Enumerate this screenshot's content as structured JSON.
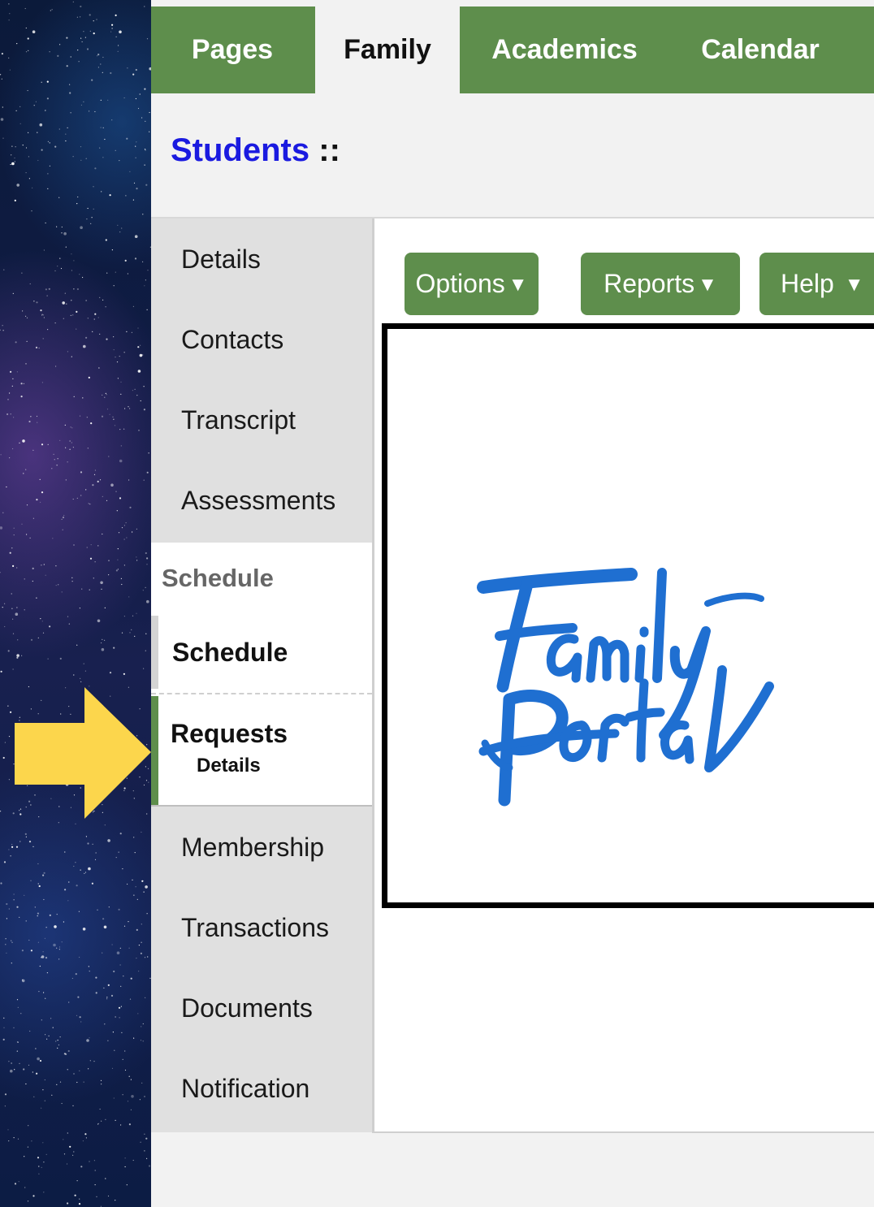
{
  "nav": {
    "tabs": [
      {
        "label": "Pages",
        "active": false
      },
      {
        "label": "Family",
        "active": true
      },
      {
        "label": "Academics",
        "active": false
      },
      {
        "label": "Calendar",
        "active": false
      }
    ]
  },
  "header": {
    "breadcrumb": "Students",
    "separator": "::"
  },
  "sidebar": {
    "items_top": [
      "Details",
      "Contacts",
      "Transcript",
      "Assessments"
    ],
    "section_label": "Schedule",
    "schedule_item": "Schedule",
    "requests_item": "Requests",
    "requests_sub": "Details",
    "items_bottom": [
      "Membership",
      "Transactions",
      "Documents",
      "Notification"
    ]
  },
  "toolbar": {
    "options_label": "Options",
    "reports_label": "Reports",
    "help_label": "Help",
    "caret": "▼"
  },
  "logo": {
    "text_line1": "Family",
    "text_line2": "Portal",
    "color": "#1f6fd1"
  },
  "colors": {
    "nav_green": "#5e8e4c",
    "link_blue": "#1a1ae0",
    "arrow_yellow": "#fcd64c"
  }
}
